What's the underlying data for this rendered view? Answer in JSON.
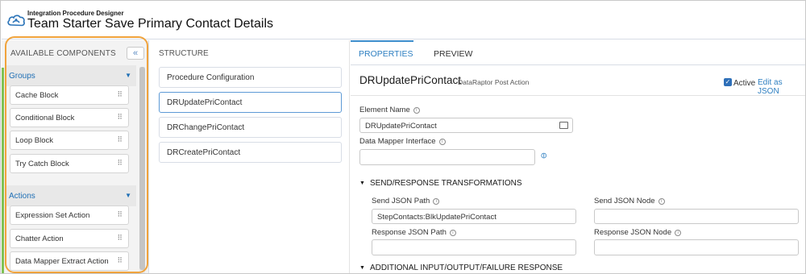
{
  "header": {
    "subtitle": "Integration Procedure Designer",
    "title": "Team Starter Save Primary Contact Details",
    "logo_icon": "cloud-icon"
  },
  "components_panel": {
    "title": "AVAILABLE COMPONENTS",
    "collapse_label": "«",
    "groups": {
      "label": "Groups",
      "items": [
        "Cache Block",
        "Conditional Block",
        "Loop Block",
        "Try Catch Block"
      ]
    },
    "actions": {
      "label": "Actions",
      "items": [
        "Expression Set Action",
        "Chatter Action",
        "Data Mapper Extract Action"
      ]
    }
  },
  "structure_panel": {
    "title": "STRUCTURE",
    "items": [
      "Procedure Configuration",
      "DRUpdatePriContact",
      "DRChangePriContact",
      "DRCreatePriContact"
    ],
    "selected_index": 1
  },
  "properties_panel": {
    "tabs": [
      "PROPERTIES",
      "PREVIEW"
    ],
    "active_tab": "PROPERTIES",
    "element_title": "DRUpdatePriContact",
    "element_type": "DataRaptor Post Action",
    "active_label": "Active",
    "active_checked": true,
    "edit_json_label": "Edit as JSON",
    "element_name": {
      "label": "Element Name",
      "value": "DRUpdatePriContact"
    },
    "data_mapper_interface": {
      "label": "Data Mapper Interface",
      "value": ""
    },
    "send_response_section": "SEND/RESPONSE TRANSFORMATIONS",
    "send_json_path": {
      "label": "Send JSON Path",
      "value": "StepContacts:BlkUpdatePriContact"
    },
    "send_json_node": {
      "label": "Send JSON Node",
      "value": ""
    },
    "response_json_path": {
      "label": "Response JSON Path",
      "value": ""
    },
    "response_json_node": {
      "label": "Response JSON Node",
      "value": ""
    },
    "additional_section": "ADDITIONAL INPUT/OUTPUT/FAILURE RESPONSE"
  },
  "colors": {
    "accent_blue": "#2e7fc1",
    "highlight_orange": "#f0a33c",
    "left_accent_green": "#7fc254"
  }
}
